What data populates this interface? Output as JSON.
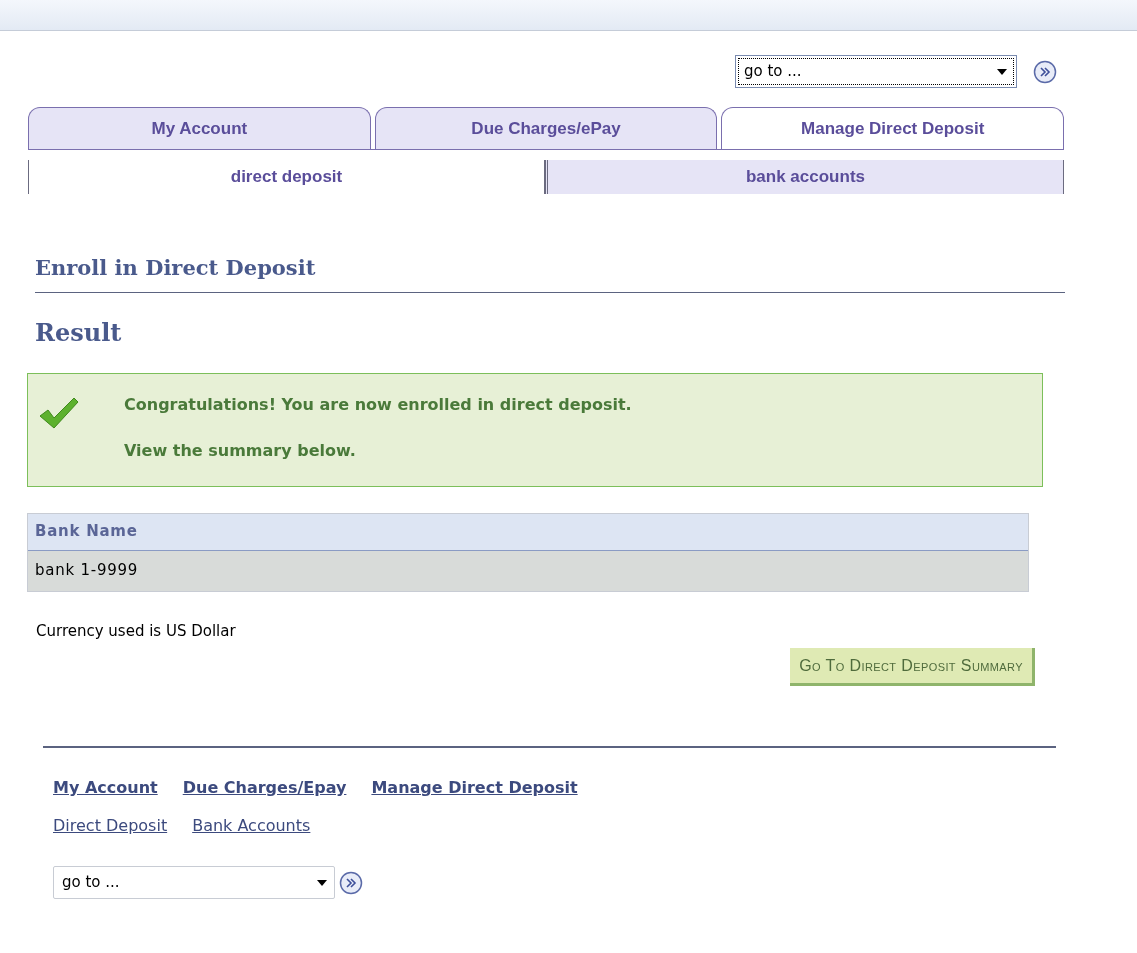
{
  "goto_top": {
    "value": "go to ..."
  },
  "tabs": [
    {
      "label": "My Account",
      "selected": false
    },
    {
      "label": "Due Charges/ePay",
      "selected": false
    },
    {
      "label": "Manage Direct Deposit",
      "selected": true
    }
  ],
  "subtabs": [
    {
      "label": "direct deposit",
      "selected": true
    },
    {
      "label": "bank accounts",
      "selected": false
    }
  ],
  "page_title": "Enroll in Direct Deposit",
  "section_title": "Result",
  "message": {
    "lines": [
      "Congratulations! You are now enrolled in direct deposit.",
      "View the summary below."
    ]
  },
  "table": {
    "columns": [
      "Bank Name"
    ],
    "rows": [
      [
        "bank 1-9999"
      ]
    ]
  },
  "currency_note": "Currency used is US Dollar",
  "summary_button": "Go To Direct Deposit Summary",
  "footer_links": [
    [
      "My Account",
      "Due Charges/Epay",
      "Manage Direct Deposit"
    ],
    [
      "Direct Deposit",
      "Bank Accounts"
    ]
  ],
  "goto_bottom": {
    "value": "go to ..."
  }
}
